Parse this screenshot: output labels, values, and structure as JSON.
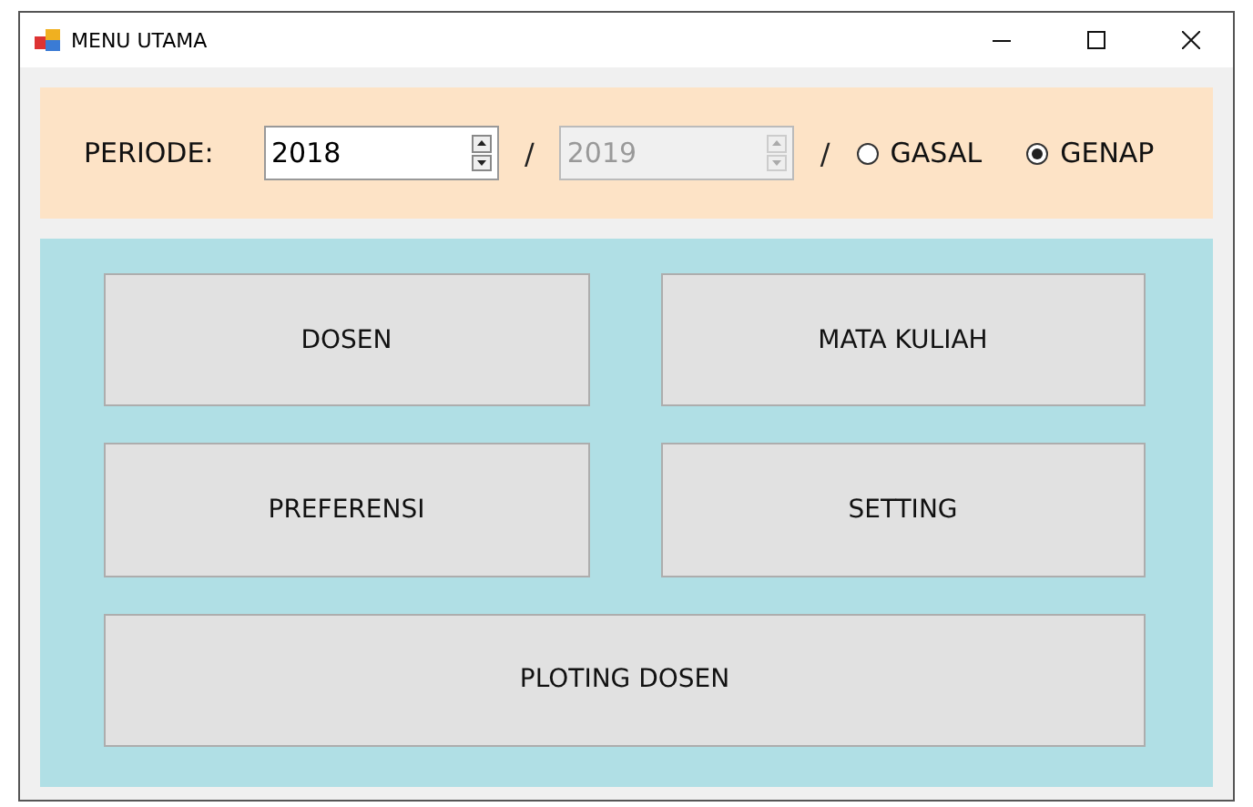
{
  "window": {
    "title": "MENU UTAMA"
  },
  "periode": {
    "label": "PERIODE:",
    "separators": [
      "/",
      "/"
    ],
    "spinners": [
      {
        "value": "2018",
        "disabled": false
      },
      {
        "value": "2019",
        "disabled": true
      }
    ],
    "radios": [
      {
        "label": "GASAL",
        "selected": false
      },
      {
        "label": "GENAP",
        "selected": true
      }
    ]
  },
  "buttons": [
    {
      "label": "DOSEN",
      "wide": false
    },
    {
      "label": "MATA KULIAH",
      "wide": false
    },
    {
      "label": "PREFERENSI",
      "wide": false
    },
    {
      "label": "SETTING",
      "wide": false
    },
    {
      "label": "PLOTING DOSEN",
      "wide": true
    }
  ]
}
